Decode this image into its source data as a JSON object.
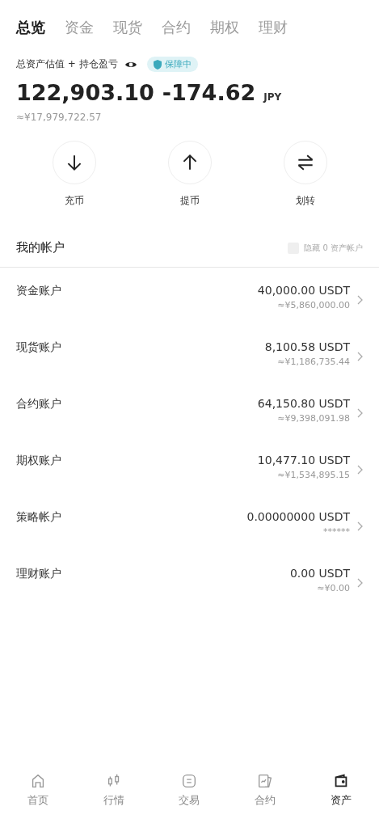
{
  "tabs": [
    {
      "label": "总览",
      "selected": true
    },
    {
      "label": "资金",
      "selected": false
    },
    {
      "label": "现货",
      "selected": false
    },
    {
      "label": "合约",
      "selected": false
    },
    {
      "label": "期权",
      "selected": false
    },
    {
      "label": "理财",
      "selected": false
    }
  ],
  "summary": {
    "label": "总资产估值 + 持仓盈亏",
    "badge": "保障中",
    "total": "122,903.10",
    "pnl": "-174.62",
    "currency": "JPY",
    "approx": "≈¥17,979,722.57"
  },
  "actions": [
    {
      "kind": "deposit",
      "label": "充币"
    },
    {
      "kind": "withdraw",
      "label": "提币"
    },
    {
      "kind": "transfer",
      "label": "划转"
    }
  ],
  "accounts_header": {
    "title": "我的帐户",
    "hide_zero": {
      "label": "隐藏 0 资产帐户",
      "checked": false
    }
  },
  "accounts": [
    {
      "name": "资金账户",
      "amount": "40,000.00 USDT",
      "approx": "≈¥5,860,000.00"
    },
    {
      "name": "现货账户",
      "amount": "8,100.58 USDT",
      "approx": "≈¥1,186,735.44"
    },
    {
      "name": "合约账户",
      "amount": "64,150.80 USDT",
      "approx": "≈¥9,398,091.98"
    },
    {
      "name": "期权账户",
      "amount": "10,477.10 USDT",
      "approx": "≈¥1,534,895.15"
    },
    {
      "name": "策略帐户",
      "amount": "0.00000000 USDT",
      "approx": "******"
    },
    {
      "name": "理财账户",
      "amount": "0.00 USDT",
      "approx": "≈¥0.00"
    }
  ],
  "nav": [
    {
      "kind": "home",
      "label": "首页",
      "selected": false
    },
    {
      "kind": "market",
      "label": "行情",
      "selected": false
    },
    {
      "kind": "trade",
      "label": "交易",
      "selected": false
    },
    {
      "kind": "futures",
      "label": "合约",
      "selected": false
    },
    {
      "kind": "assets",
      "label": "资产",
      "selected": true
    }
  ]
}
